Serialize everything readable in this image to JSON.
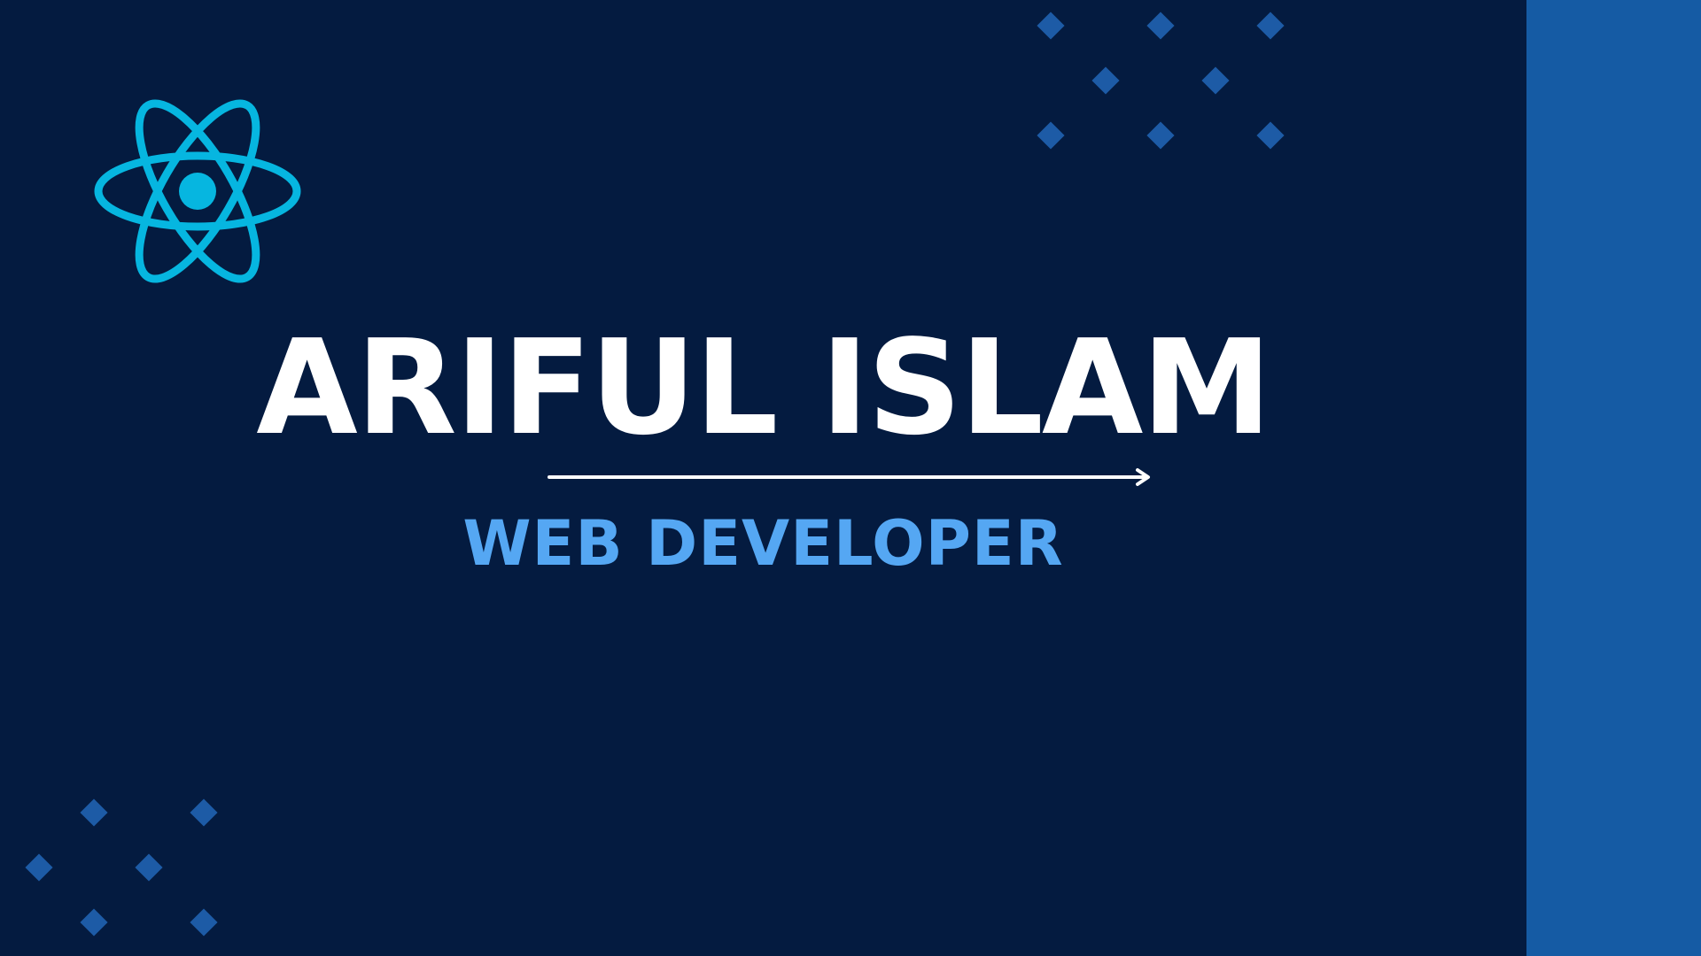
{
  "banner": {
    "name": "ARIFUL ISLAM",
    "role": "WEB DEVELOPER",
    "logo_icon": "react-atom-icon",
    "decor_icon": "diamond-icon"
  },
  "colors": {
    "background": "#041b40",
    "side_bar": "#155ba4",
    "logo": "#06b6e0",
    "name_text": "#ffffff",
    "role_text": "#55a7f3",
    "diamonds": "#1d5ba6",
    "arrow": "#ffffff"
  }
}
